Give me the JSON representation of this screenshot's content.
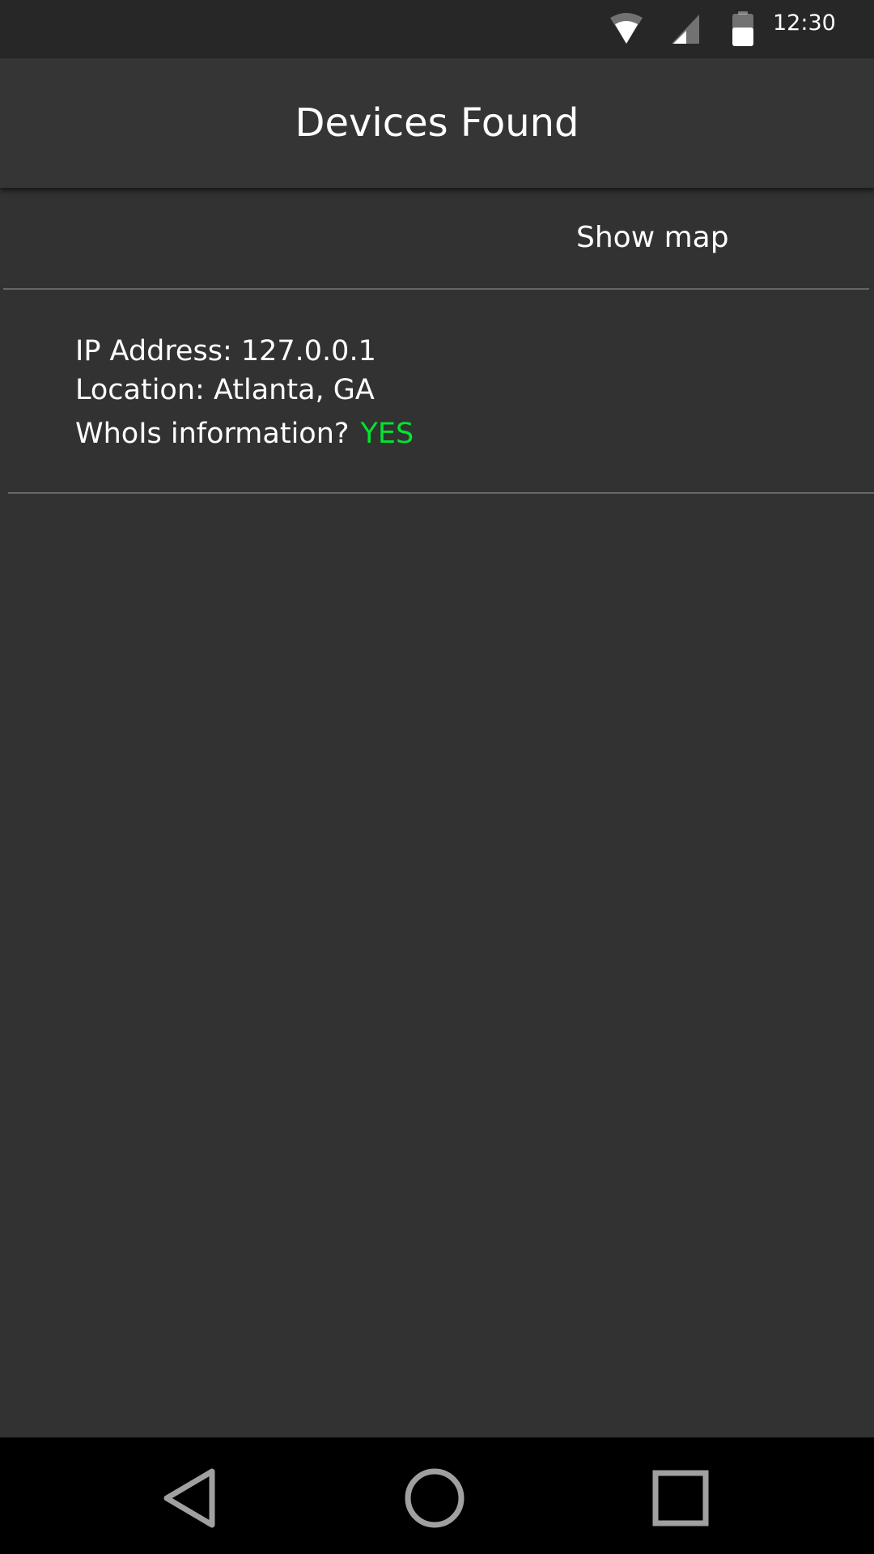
{
  "status_bar": {
    "time": "12:30",
    "icons": [
      "wifi-icon",
      "cell-signal-icon",
      "battery-icon"
    ]
  },
  "app_bar": {
    "title": "Devices Found"
  },
  "actions": {
    "show_map_label": "Show map"
  },
  "devices": [
    {
      "ip_line": "IP Address: 127.0.0.1",
      "location_line": "Location: Atlanta, GA",
      "whois_label": "WhoIs information?",
      "whois_value": "YES"
    }
  ],
  "nav_bar": {
    "icons": [
      "back-icon",
      "home-icon",
      "recents-icon"
    ]
  },
  "colors": {
    "background": "#323232",
    "app_bar": "#353535",
    "status_bar": "#272727",
    "whois_yes": "#00e62e",
    "divider": "#666666"
  }
}
